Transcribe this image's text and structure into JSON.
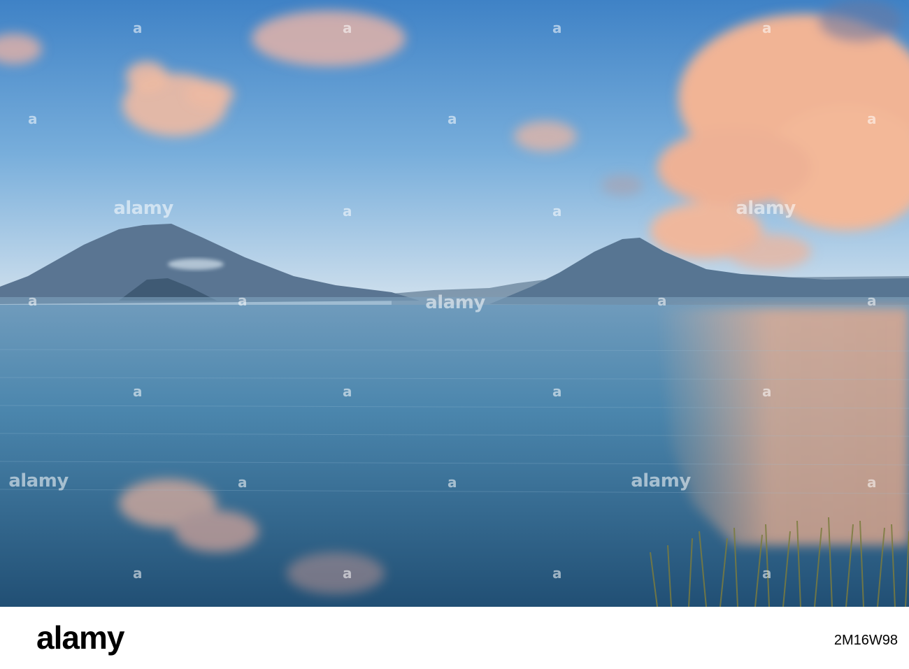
{
  "photo": {
    "subject": "lake-with-volcanoes",
    "colors": {
      "sky_top": "#4a8ccc",
      "sky_horizon": "#c9dced",
      "cloud_pink": "#f2b597",
      "water_deep": "#2a5f86",
      "water_light": "#5b93b6",
      "mountain": "#5a7390",
      "reed": "#7a7a3a"
    }
  },
  "watermark": {
    "text": "alamy",
    "mark": "a"
  },
  "footer": {
    "logo": "alamy",
    "image_id": "2M16W98"
  }
}
